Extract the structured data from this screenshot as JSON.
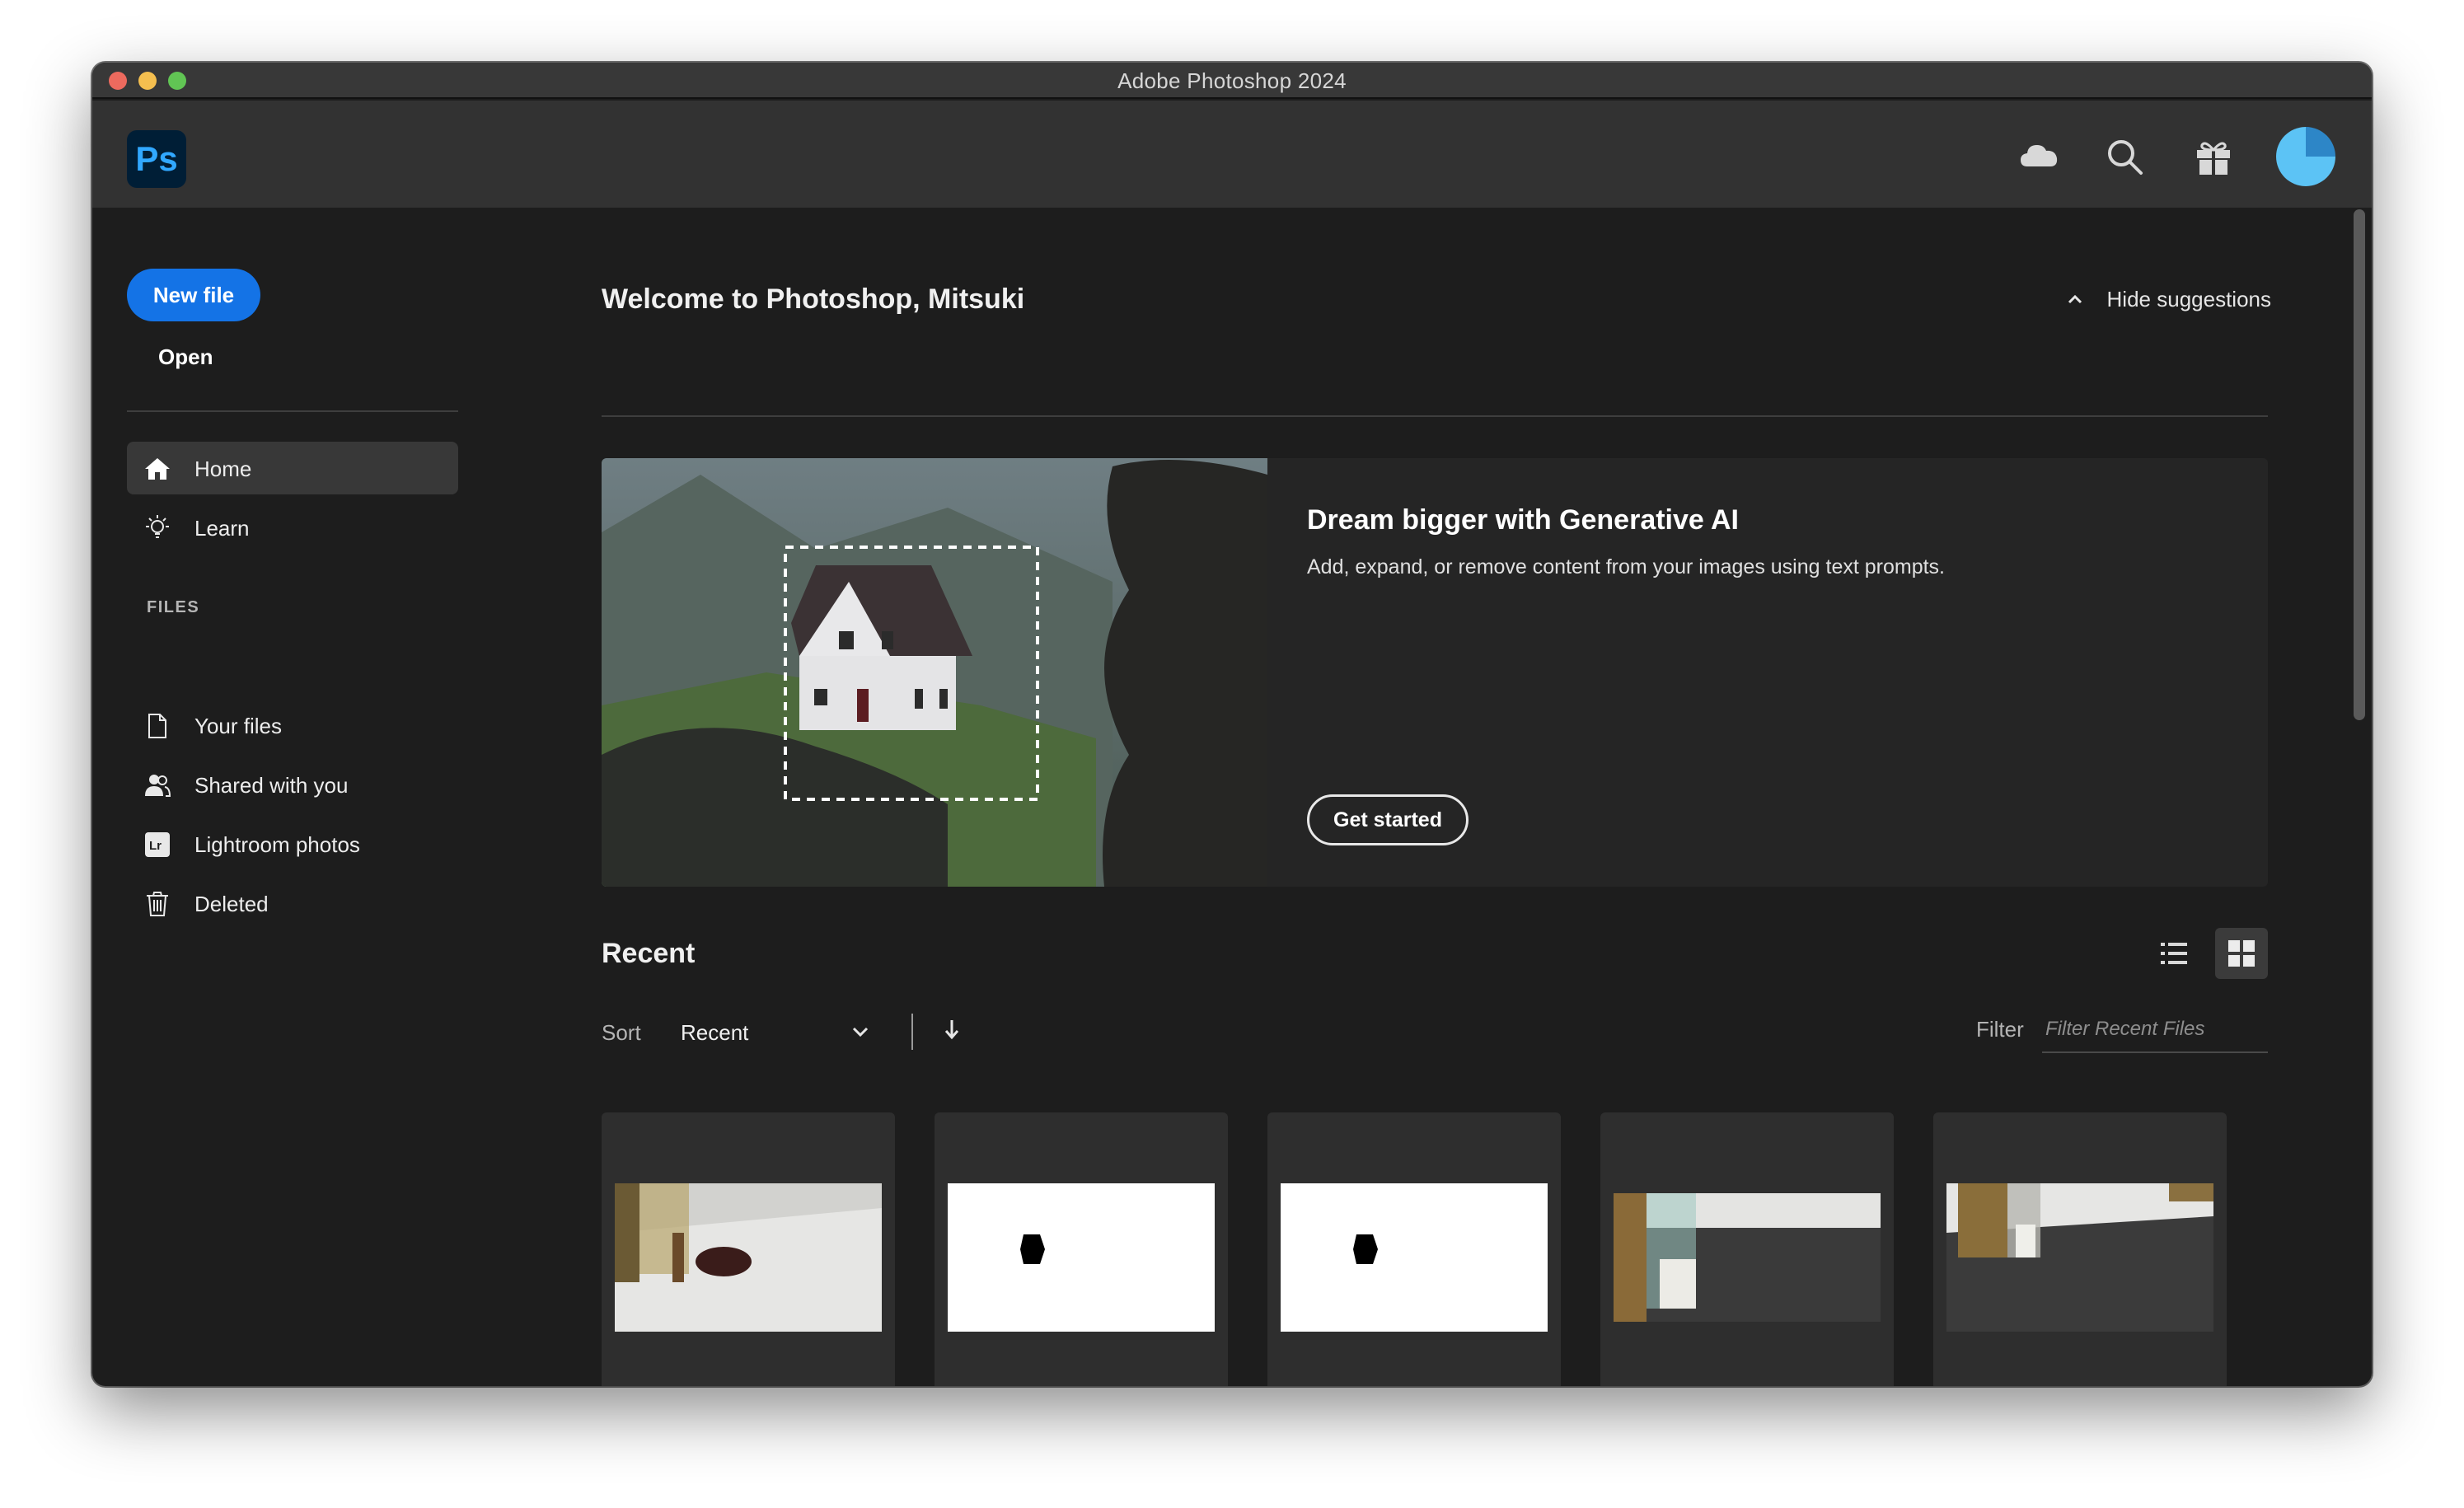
{
  "window": {
    "title": "Adobe Photoshop 2024"
  },
  "header": {
    "logo_text": "Ps",
    "icons": [
      "cloud-icon",
      "search-icon",
      "gift-icon"
    ],
    "brand_color": "#31a8ff"
  },
  "sidebar": {
    "new_file_label": "New file",
    "open_label": "Open",
    "nav": [
      {
        "label": "Home",
        "icon": "home-icon",
        "active": true
      },
      {
        "label": "Learn",
        "icon": "lightbulb-icon"
      }
    ],
    "files_heading": "FILES",
    "files": [
      {
        "label": "Your files",
        "icon": "document-icon"
      },
      {
        "label": "Shared with you",
        "icon": "shared-users-icon"
      },
      {
        "label": "Lightroom photos",
        "icon": "lightroom-icon"
      },
      {
        "label": "Deleted",
        "icon": "trash-icon"
      }
    ]
  },
  "main": {
    "welcome": "Welcome to Photoshop, Mitsuki",
    "hide_suggestions": "Hide suggestions",
    "promo": {
      "title": "Dream bigger with Generative AI",
      "subtitle": "Add, expand, or remove content from your images using text prompts.",
      "cta": "Get started"
    },
    "recent": {
      "title": "Recent",
      "sort_label": "Sort",
      "sort_value": "Recent",
      "filter_label": "Filter",
      "filter_placeholder": "Filter Recent Files",
      "files": [
        {
          "thumb": "glass-on-white"
        },
        {
          "thumb": "black-shape-on-white"
        },
        {
          "thumb": "black-shape-on-white"
        },
        {
          "thumb": "glass-on-dark"
        },
        {
          "thumb": "glass-on-dark"
        }
      ]
    }
  },
  "colors": {
    "accent": "#1473e6",
    "background": "#1d1d1d",
    "panel": "#252525"
  }
}
